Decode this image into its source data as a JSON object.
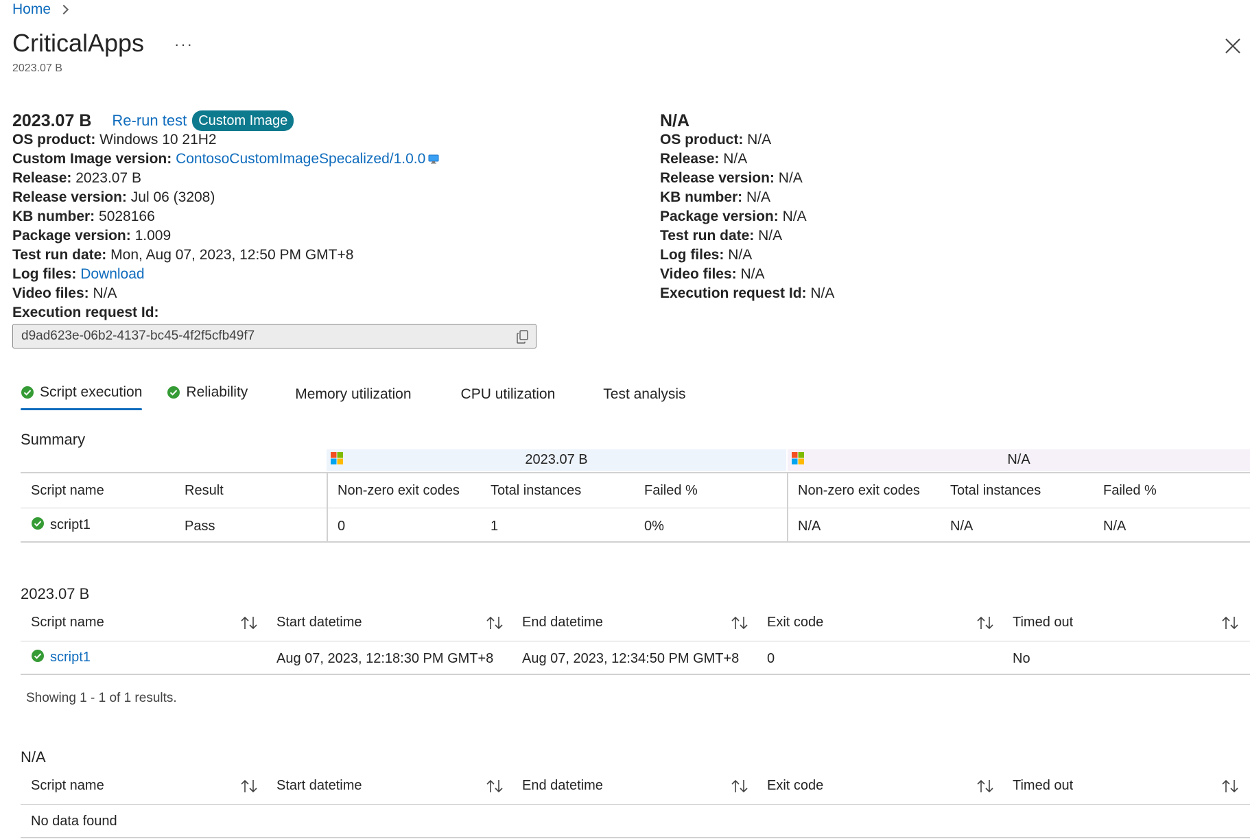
{
  "breadcrumb": {
    "home": "Home"
  },
  "header": {
    "title": "CriticalApps",
    "more": "···",
    "subtitle": "2023.07 B"
  },
  "left_info": {
    "title": "2023.07 B",
    "rerun": "Re-run test",
    "badge": "Custom Image",
    "os_product_label": "OS product:",
    "os_product": "Windows 10 21H2",
    "custom_image_label": "Custom Image version:",
    "custom_image": "ContosoCustomImageSpecalized/1.0.0",
    "release_label": "Release:",
    "release": "2023.07 B",
    "release_version_label": "Release version:",
    "release_version": "Jul 06 (3208)",
    "kb_label": "KB number:",
    "kb": "5028166",
    "package_label": "Package version:",
    "package": "1.009",
    "test_run_label": "Test run date:",
    "test_run": "Mon, Aug 07, 2023, 12:50 PM GMT+8",
    "log_label": "Log files:",
    "log": "Download",
    "video_label": "Video files:",
    "video": "N/A",
    "exec_label": "Execution request Id:",
    "exec_id": "d9ad623e-06b2-4137-bc45-4f2f5cfb49f7"
  },
  "right_info": {
    "title": "N/A",
    "os_product_label": "OS product:",
    "os_product": "N/A",
    "release_label": "Release:",
    "release": "N/A",
    "release_version_label": "Release version:",
    "release_version": "N/A",
    "kb_label": "KB number:",
    "kb": "N/A",
    "package_label": "Package version:",
    "package": "N/A",
    "test_run_label": "Test run date:",
    "test_run": "N/A",
    "log_label": "Log files:",
    "log": "N/A",
    "video_label": "Video files:",
    "video": "N/A",
    "exec_label": "Execution request Id:",
    "exec": "N/A"
  },
  "tabs": [
    {
      "label": "Script execution",
      "status": "pass",
      "active": true
    },
    {
      "label": "Reliability",
      "status": "pass",
      "active": false
    },
    {
      "label": "Memory utilization",
      "status": "",
      "active": false
    },
    {
      "label": "CPU utilization",
      "status": "",
      "active": false
    },
    {
      "label": "Test analysis",
      "status": "",
      "active": false
    }
  ],
  "summary": {
    "title": "Summary",
    "group_a": "2023.07 B",
    "group_b": "N/A",
    "headers": [
      "Script name",
      "Result",
      "Non-zero exit codes",
      "Total instances",
      "Failed %",
      "Non-zero exit codes",
      "Total instances",
      "Failed %"
    ],
    "rows": [
      [
        "script1",
        "Pass",
        "0",
        "1",
        "0%",
        "N/A",
        "N/A",
        "N/A"
      ]
    ]
  },
  "table_a": {
    "title": "2023.07 B",
    "headers": [
      "Script name",
      "Start datetime",
      "End datetime",
      "Exit code",
      "Timed out"
    ],
    "rows": [
      [
        "script1",
        "Aug 07, 2023, 12:18:30 PM GMT+8",
        "Aug 07, 2023, 12:34:50 PM GMT+8",
        "0",
        "No"
      ]
    ],
    "footer": "Showing 1 - 1 of 1 results."
  },
  "table_b": {
    "title": "N/A",
    "headers": [
      "Script name",
      "Start datetime",
      "End datetime",
      "Exit code",
      "Timed out"
    ],
    "empty": "No data found"
  },
  "colors": {
    "accent": "#0f6cbd",
    "success": "#359b35",
    "badge": "#0e7a8e",
    "band_a": "#eef4fc",
    "band_b": "#f6f1f8"
  },
  "icons": {
    "more": "more-horizontal-icon",
    "close": "close-icon",
    "copy": "copy-icon",
    "check": "check-circle-icon",
    "sort": "sort-arrows-icon",
    "windows": "windows-logo-icon",
    "monitor": "monitor-icon"
  }
}
